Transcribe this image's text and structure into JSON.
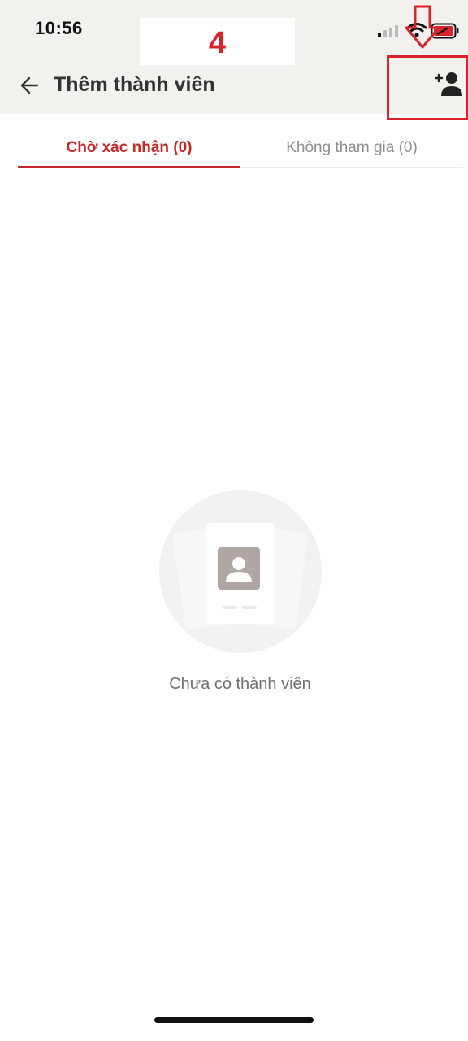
{
  "status_bar": {
    "time": "10:56"
  },
  "annotation": {
    "step_number": "4",
    "highlight_color": "#d8232a"
  },
  "header": {
    "title": "Thêm thành viên",
    "back_icon": "arrow-left-icon",
    "action_icon": "add-person-icon"
  },
  "tabs": [
    {
      "label": "Chờ xác nhận (0)",
      "active": true
    },
    {
      "label": "Không tham gia (0)",
      "active": false
    }
  ],
  "empty_state": {
    "icon": "contact-card-icon",
    "text": "Chưa có thành viên"
  },
  "colors": {
    "accent": "#c62828",
    "header_background": "#f3f1ee"
  }
}
